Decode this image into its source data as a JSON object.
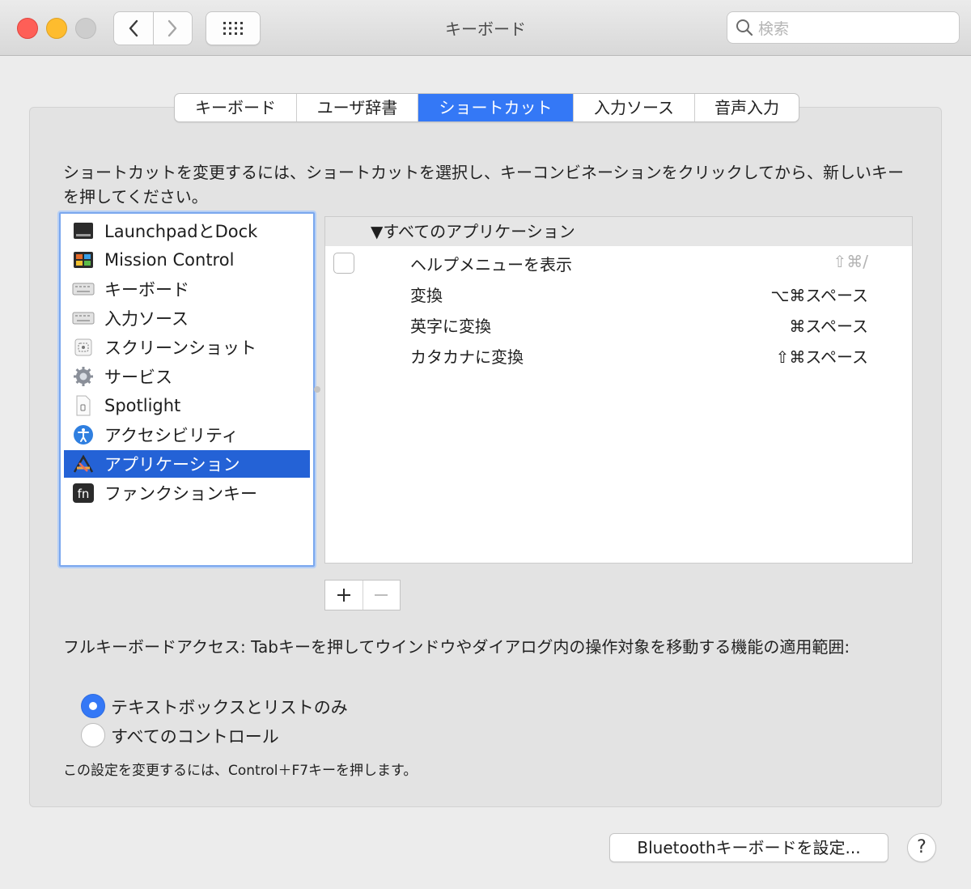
{
  "window": {
    "title": "キーボード"
  },
  "search": {
    "placeholder": "検索"
  },
  "tabs": [
    {
      "label": "キーボード"
    },
    {
      "label": "ユーザ辞書"
    },
    {
      "label": "ショートカット"
    },
    {
      "label": "入力ソース"
    },
    {
      "label": "音声入力"
    }
  ],
  "active_tab": "ショートカット",
  "description": "ショートカットを変更するには、ショートカットを選択し、キーコンビネーションをクリックしてから、新しいキーを押してください。",
  "categories": [
    {
      "label": "LaunchpadとDock",
      "icon": "launchpad-dock-icon"
    },
    {
      "label": "Mission Control",
      "icon": "mission-control-icon"
    },
    {
      "label": "キーボード",
      "icon": "keyboard-icon"
    },
    {
      "label": "入力ソース",
      "icon": "input-source-icon"
    },
    {
      "label": "スクリーンショット",
      "icon": "screenshot-icon"
    },
    {
      "label": "サービス",
      "icon": "services-gear-icon"
    },
    {
      "label": "Spotlight",
      "icon": "spotlight-icon"
    },
    {
      "label": "アクセシビリティ",
      "icon": "accessibility-icon"
    },
    {
      "label": "アプリケーション",
      "icon": "applications-icon"
    },
    {
      "label": "ファンクションキー",
      "icon": "function-key-icon"
    }
  ],
  "selected_category": "アプリケーション",
  "shortcuts": {
    "group_label": "▼すべてのアプリケーション",
    "rows": [
      {
        "name": "ヘルプメニューを表示",
        "key": "⇧⌘/",
        "checked": false,
        "enabled": false
      },
      {
        "name": "変換",
        "key": "⌥⌘スペース",
        "enabled": true
      },
      {
        "name": "英字に変換",
        "key": "⌘スペース",
        "enabled": true
      },
      {
        "name": "カタカナに変換",
        "key": "⇧⌘スペース",
        "enabled": true
      }
    ]
  },
  "buttons": {
    "add": "+",
    "remove": "−",
    "bluetooth": "Bluetoothキーボードを設定...",
    "help": "?"
  },
  "full_keyboard_access": {
    "label": "フルキーボードアクセス: Tabキーを押してウインドウやダイアログ内の操作対象を移動する機能の適用範囲:",
    "options": [
      {
        "label": "テキストボックスとリストのみ",
        "selected": true
      },
      {
        "label": "すべてのコントロール",
        "selected": false
      }
    ],
    "note": "この設定を変更するには、Control＋F7キーを押します。"
  },
  "colors": {
    "accent": "#3478f6",
    "selection": "#2462d6"
  }
}
